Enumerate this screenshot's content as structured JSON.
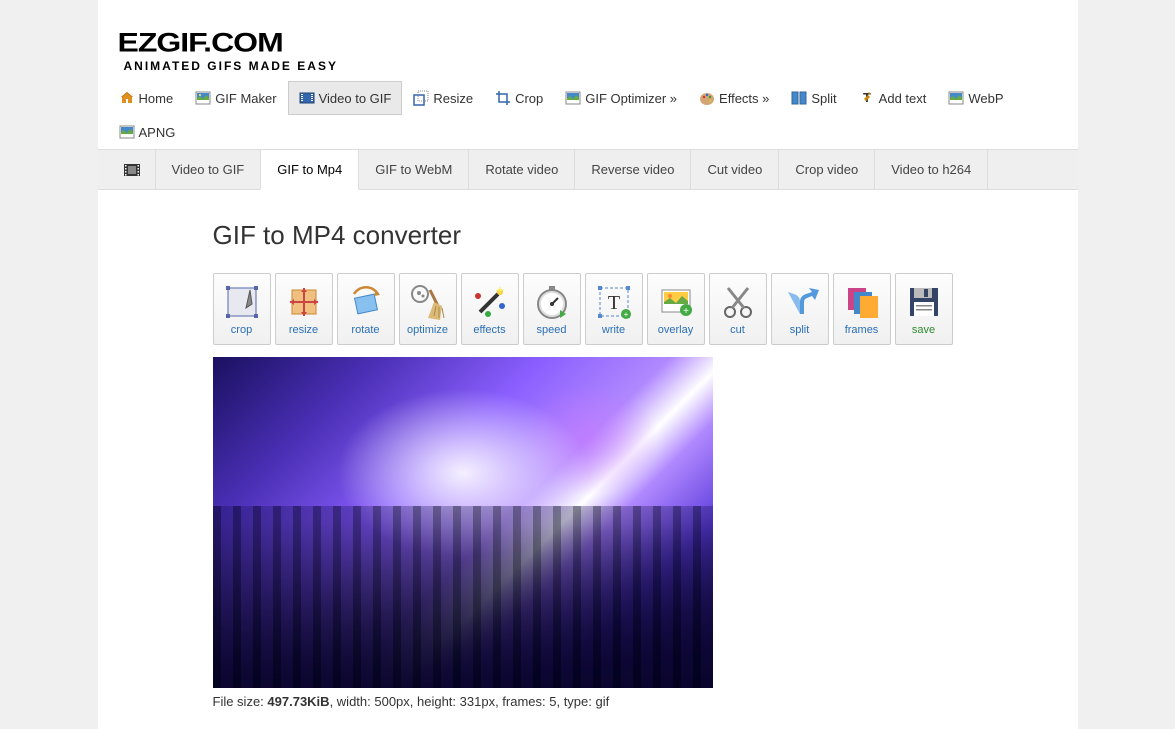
{
  "logo": {
    "main": "EZGIF.COM",
    "sub": "ANIMATED GIFS MADE EASY"
  },
  "mainNav": {
    "home": "Home",
    "gifMaker": "GIF Maker",
    "videoToGif": "Video to GIF",
    "resize": "Resize",
    "crop": "Crop",
    "gifOptimizer": "GIF Optimizer »",
    "effects": "Effects »",
    "split": "Split",
    "addText": "Add text",
    "webp": "WebP",
    "apng": "APNG"
  },
  "subNav": {
    "videoToGif": "Video to GIF",
    "gifToMp4": "GIF to Mp4",
    "gifToWebm": "GIF to WebM",
    "rotateVideo": "Rotate video",
    "reverseVideo": "Reverse video",
    "cutVideo": "Cut video",
    "cropVideo": "Crop video",
    "videoToH264": "Video to h264"
  },
  "pageTitle": "GIF to MP4 converter",
  "tools": {
    "crop": "crop",
    "resize": "resize",
    "rotate": "rotate",
    "optimize": "optimize",
    "effects": "effects",
    "speed": "speed",
    "write": "write",
    "overlay": "overlay",
    "cut": "cut",
    "split": "split",
    "frames": "frames",
    "save": "save"
  },
  "fileInfo": {
    "prefix": "File size: ",
    "size": "497.73KiB",
    "rest": ", width: 500px, height: 331px, frames: 5, type: gif"
  }
}
